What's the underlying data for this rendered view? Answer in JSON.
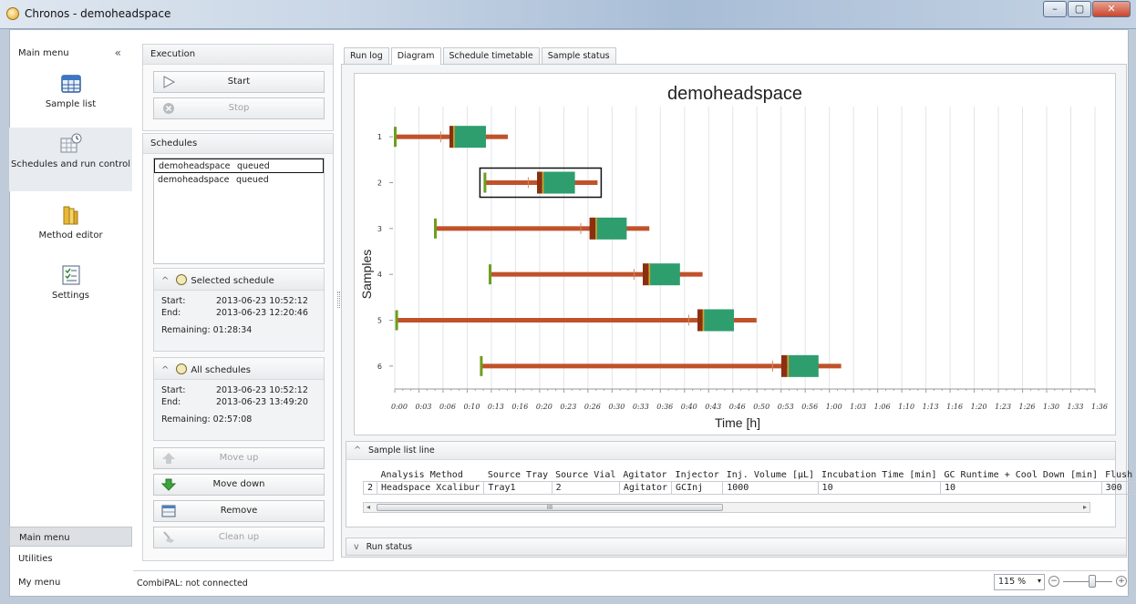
{
  "window": {
    "title": "Chronos - demoheadspace",
    "buttons": [
      "–",
      "▢",
      "✕"
    ]
  },
  "nav": {
    "header": "Main menu",
    "collapse": "«",
    "items": [
      {
        "label": "Sample list",
        "icon": "table-icon"
      },
      {
        "label": "Schedules and run control",
        "icon": "calendar-clock-icon"
      },
      {
        "label": "Method editor",
        "icon": "folder-icon"
      },
      {
        "label": "Settings",
        "icon": "checklist-icon"
      }
    ],
    "bottom": [
      "Main menu",
      "Utilities",
      "My menu"
    ]
  },
  "execution": {
    "header": "Execution",
    "start_label": "Start",
    "stop_label": "Stop"
  },
  "schedules": {
    "header": "Schedules",
    "rows": [
      {
        "name": "demoheadspace",
        "status": "queued"
      },
      {
        "name": "demoheadspace",
        "status": "queued"
      }
    ]
  },
  "selected_schedule": {
    "header": "Selected schedule",
    "start_key": "Start:",
    "start": "2013-06-23 10:52:12",
    "end_key": "End:",
    "end": "2013-06-23 12:20:46",
    "remaining": "Remaining: 01:28:34"
  },
  "all_schedules": {
    "header": "All schedules",
    "start_key": "Start:",
    "start": "2013-06-23 10:52:12",
    "end_key": "End:",
    "end": "2013-06-23 13:49:20",
    "remaining": "Remaining: 02:57:08"
  },
  "actions": {
    "move_up": "Move up",
    "move_down": "Move down",
    "remove": "Remove",
    "clean_up": "Clean up"
  },
  "tabs": [
    "Run log",
    "Diagram",
    "Schedule timetable",
    "Sample status"
  ],
  "active_tab": "Diagram",
  "colors": {
    "wait": "#c0522a",
    "incubation": "#2e9e6e",
    "inject": "#6d9e1f",
    "marker": "#8a3010"
  },
  "chart_data": {
    "type": "gantt",
    "title": "demoheadspace",
    "xlabel": "Time [h]",
    "ylabel": "Samples",
    "x_ticks": [
      "0:00",
      "0:03",
      "0:06",
      "0:10",
      "0:13",
      "0:16",
      "0:20",
      "0:23",
      "0:26",
      "0:30",
      "0:33",
      "0:36",
      "0:40",
      "0:43",
      "0:46",
      "0:50",
      "0:53",
      "0:56",
      "1:00",
      "1:03",
      "1:06",
      "1:10",
      "1:13",
      "1:16",
      "1:20",
      "1:23",
      "1:26",
      "1:30",
      "1:33",
      "1:36"
    ],
    "xlim_min": [
      0,
      96
    ],
    "grid": true,
    "samples": [
      {
        "id": "1",
        "start": 0.0,
        "marker": 7.5,
        "incubation": [
          8.0,
          12.5
        ],
        "end": 15.5
      },
      {
        "id": "2",
        "start": 12.3,
        "marker": 19.5,
        "incubation": [
          20.2,
          24.7
        ],
        "end": 27.8,
        "selected": true
      },
      {
        "id": "3",
        "start": 5.5,
        "marker": 26.7,
        "incubation": [
          27.5,
          31.8
        ],
        "end": 34.9
      },
      {
        "id": "4",
        "start": 13.0,
        "marker": 34.0,
        "incubation": [
          34.8,
          39.1
        ],
        "end": 42.2
      },
      {
        "id": "5",
        "start": 0.2,
        "marker": 41.5,
        "incubation": [
          42.2,
          46.5
        ],
        "end": 49.6
      },
      {
        "id": "6",
        "start": 11.8,
        "marker": 53.0,
        "incubation": [
          53.8,
          58.1
        ],
        "end": 61.2
      }
    ]
  },
  "sample_list_line": {
    "header": "Sample list line",
    "columns": [
      "",
      "Analysis Method",
      "Source Tray",
      "Source Vial",
      "Agitator",
      "Injector",
      "Inj. Volume [µL]",
      "Incubation Time [min]",
      "GC Runtime + Cool Down [min]",
      "Flush T"
    ],
    "row": [
      "2",
      "Headspace Xcalibur",
      "Tray1",
      "2",
      "Agitator",
      "GCInj",
      "1000",
      "10",
      "10",
      "300"
    ]
  },
  "scrollbar_grip": "III",
  "run_status": "Run status",
  "status": {
    "connection": "CombiPAL: not connected",
    "zoom": "115 %"
  }
}
